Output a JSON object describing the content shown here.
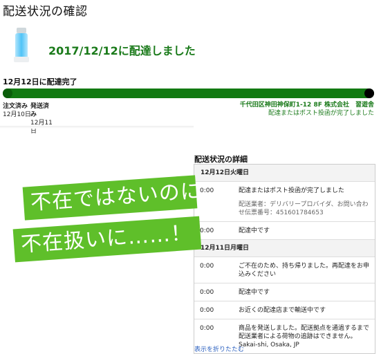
{
  "page": {
    "title": "配送状況の確認"
  },
  "summary": {
    "delivered_text": "2017/12/12に配達しました"
  },
  "progress": {
    "heading": "12月12日に配達完了",
    "steps": [
      {
        "label": "注文済み",
        "date": "12月10日"
      },
      {
        "label": "発送済み",
        "date": "12月11日"
      }
    ],
    "location": "千代田区神田神保町1-12 8F 株式会社　習遊舎",
    "location_note": "配達またはポスト投函が完了しました",
    "percent": 100,
    "bar_color": "#127a12"
  },
  "details": {
    "title": "配送状況の詳細",
    "days": [
      {
        "day": "12月12日火曜日",
        "events": [
          {
            "time": "0:00",
            "text": "配達またはポスト投函が完了しました",
            "sub": "配送業者：デリバリープロバイダ、お問い合わせ伝票番号：451601784653"
          },
          {
            "time": "0:00",
            "text": "配達中です",
            "sub": ""
          }
        ]
      },
      {
        "day": "12月11日月曜日",
        "events": [
          {
            "time": "0:00",
            "text": "ご不在のため、持ち帰りました。再配達をお申込みください",
            "sub": ""
          },
          {
            "time": "0:00",
            "text": "配達中です",
            "sub": ""
          },
          {
            "time": "0:00",
            "text": "お近くの配達店まで輸送中です",
            "sub": ""
          },
          {
            "time": "0:00",
            "text": "商品を発送しました。配送拠点を通過するまで配送業者による荷物の追跡はできません。",
            "sub": "Sakai-shi, Osaka, JP"
          }
        ]
      }
    ],
    "collapse_link": "表示を折りたたむ"
  },
  "overlay": {
    "line1": "不在ではないのに",
    "line2": "不在扱いに……！",
    "color": "#5fbf2a"
  }
}
